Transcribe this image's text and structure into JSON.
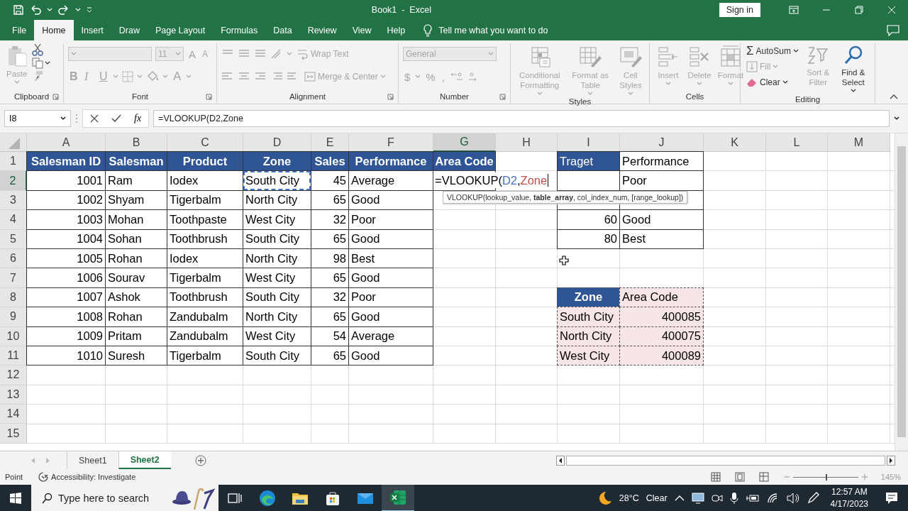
{
  "window": {
    "title": "Book1  -  Excel",
    "sign_in": "Sign in"
  },
  "menu_tabs": [
    {
      "label": "File",
      "selected": false
    },
    {
      "label": "Home",
      "selected": true
    },
    {
      "label": "Insert",
      "selected": false
    },
    {
      "label": "Draw",
      "selected": false
    },
    {
      "label": "Page Layout",
      "selected": false
    },
    {
      "label": "Formulas",
      "selected": false
    },
    {
      "label": "Data",
      "selected": false
    },
    {
      "label": "Review",
      "selected": false
    },
    {
      "label": "View",
      "selected": false
    },
    {
      "label": "Help",
      "selected": false
    }
  ],
  "tell_me": "Tell me what you want to do",
  "ribbon": {
    "clipboard": {
      "label": "Clipboard",
      "paste": "Paste",
      "disabled": true
    },
    "font": {
      "label": "Font",
      "size": "11",
      "grow": "A",
      "shrink": "A",
      "bold": "B",
      "italic": "I",
      "underline": "U",
      "text_color_letter": "A",
      "disabled": true
    },
    "alignment": {
      "label": "Alignment",
      "wrap_text": "Wrap Text",
      "merge": "Merge & Center",
      "disabled": true
    },
    "number": {
      "label": "Number",
      "format": "General",
      "currency": "$",
      "percent": "%",
      "comma": ",",
      "disabled": true
    },
    "styles": {
      "label": "Styles",
      "buttons": [
        {
          "label": "Conditional Formatting",
          "disabled": true
        },
        {
          "label": "Format as Table",
          "disabled": true
        },
        {
          "label": "Cell Styles",
          "disabled": true
        }
      ]
    },
    "cells": {
      "label": "Cells",
      "buttons": [
        {
          "label": "Insert",
          "disabled": true
        },
        {
          "label": "Delete",
          "disabled": true
        },
        {
          "label": "Format",
          "disabled": true
        }
      ]
    },
    "editing": {
      "label": "Editing",
      "sum_symbol": "Σ",
      "autosum": {
        "label": "AutoSum",
        "disabled": false
      },
      "fill": {
        "label": "Fill",
        "disabled": true
      },
      "clear": {
        "label": "Clear",
        "disabled": false
      },
      "sort": {
        "label": "Sort & Filter",
        "disabled": true
      },
      "find": {
        "label": "Find & Select",
        "disabled": false
      }
    }
  },
  "formula_bar": {
    "name_box": "I8",
    "insert_function": "fx",
    "formula": "=VLOOKUP(D2,Zone"
  },
  "sheet": {
    "columns": [
      {
        "label": "A",
        "selected": false
      },
      {
        "label": "B",
        "selected": false
      },
      {
        "label": "C",
        "selected": false
      },
      {
        "label": "D",
        "selected": false
      },
      {
        "label": "E",
        "selected": false
      },
      {
        "label": "F",
        "selected": false
      },
      {
        "label": "G",
        "selected": true
      },
      {
        "label": "H",
        "selected": false
      },
      {
        "label": "I",
        "selected": false
      },
      {
        "label": "J",
        "selected": false
      },
      {
        "label": "K",
        "selected": false
      },
      {
        "label": "L",
        "selected": false
      },
      {
        "label": "M",
        "selected": false
      }
    ],
    "rows": [
      {
        "label": "1",
        "selected": false,
        "cells": [
          {
            "kind": "header",
            "text": "Salesman ID"
          },
          {
            "kind": "header",
            "text": "Salesman"
          },
          {
            "kind": "header",
            "text": "Product"
          },
          {
            "kind": "header",
            "text": "Zone"
          },
          {
            "kind": "header",
            "text": "Sales"
          },
          {
            "kind": "header",
            "text": "Performance"
          },
          {
            "kind": "header",
            "text": "Area Code"
          },
          {
            "kind": "blank"
          },
          {
            "kind": "header-plain",
            "text": "Traget"
          },
          {
            "kind": "text",
            "text": "Performance"
          }
        ]
      },
      {
        "label": "2",
        "selected": true,
        "cells": [
          {
            "kind": "number",
            "text": "1001"
          },
          {
            "kind": "text",
            "text": "Ram"
          },
          {
            "kind": "text",
            "text": "Iodex"
          },
          {
            "kind": "ref",
            "text": "South City"
          },
          {
            "kind": "number",
            "text": "45"
          },
          {
            "kind": "text",
            "text": "Average"
          },
          {
            "kind": "formula",
            "parts": [
              {
                "text": "=VLOOKUP("
              },
              {
                "text": "D2",
                "color": "#4472c4"
              },
              {
                "text": ","
              },
              {
                "text": "Zone",
                "color": "#c0504d"
              }
            ]
          },
          {
            "kind": "blank"
          },
          {
            "kind": "boxed"
          },
          {
            "kind": "text",
            "text": "Poor"
          }
        ]
      },
      {
        "label": "3",
        "selected": false,
        "cells": [
          {
            "kind": "number",
            "text": "1002"
          },
          {
            "kind": "text",
            "text": "Shyam"
          },
          {
            "kind": "text",
            "text": "Tigerbalm"
          },
          {
            "kind": "text",
            "text": "North City"
          },
          {
            "kind": "number",
            "text": "65"
          },
          {
            "kind": "text",
            "text": "Good"
          },
          {
            "kind": "blank"
          },
          {
            "kind": "blank"
          },
          {
            "kind": "boxed"
          },
          {
            "kind": "boxed"
          }
        ]
      },
      {
        "label": "4",
        "selected": false,
        "cells": [
          {
            "kind": "number",
            "text": "1003"
          },
          {
            "kind": "text",
            "text": "Mohan"
          },
          {
            "kind": "text",
            "text": "Toothpaste"
          },
          {
            "kind": "text",
            "text": "West City"
          },
          {
            "kind": "number",
            "text": "32"
          },
          {
            "kind": "text",
            "text": "Poor"
          },
          {
            "kind": "blank"
          },
          {
            "kind": "blank"
          },
          {
            "kind": "number",
            "text": "60"
          },
          {
            "kind": "text",
            "text": "Good"
          }
        ]
      },
      {
        "label": "5",
        "selected": false,
        "cells": [
          {
            "kind": "number",
            "text": "1004"
          },
          {
            "kind": "text",
            "text": "Sohan"
          },
          {
            "kind": "text",
            "text": "Toothbrush"
          },
          {
            "kind": "text",
            "text": "South City"
          },
          {
            "kind": "number",
            "text": "65"
          },
          {
            "kind": "text",
            "text": "Good"
          },
          {
            "kind": "blank"
          },
          {
            "kind": "blank"
          },
          {
            "kind": "number",
            "text": "80"
          },
          {
            "kind": "text",
            "text": "Best"
          }
        ]
      },
      {
        "label": "6",
        "selected": false,
        "cells": [
          {
            "kind": "number",
            "text": "1005"
          },
          {
            "kind": "text",
            "text": "Rohan"
          },
          {
            "kind": "text",
            "text": "Iodex"
          },
          {
            "kind": "text",
            "text": "North City"
          },
          {
            "kind": "number",
            "text": "98"
          },
          {
            "kind": "text",
            "text": "Best"
          }
        ]
      },
      {
        "label": "7",
        "selected": false,
        "cells": [
          {
            "kind": "number",
            "text": "1006"
          },
          {
            "kind": "text",
            "text": "Sourav"
          },
          {
            "kind": "text",
            "text": "Tigerbalm"
          },
          {
            "kind": "text",
            "text": "West City"
          },
          {
            "kind": "number",
            "text": "65"
          },
          {
            "kind": "text",
            "text": "Good"
          }
        ]
      },
      {
        "label": "8",
        "selected": false,
        "cells": [
          {
            "kind": "number",
            "text": "1007"
          },
          {
            "kind": "text",
            "text": "Ashok"
          },
          {
            "kind": "text",
            "text": "Toothbrush"
          },
          {
            "kind": "text",
            "text": "South City"
          },
          {
            "kind": "number",
            "text": "32"
          },
          {
            "kind": "text",
            "text": "Poor"
          },
          {
            "kind": "blank"
          },
          {
            "kind": "blank"
          },
          {
            "kind": "lookup-header",
            "text": "Zone"
          },
          {
            "kind": "lookup-text",
            "text": "Area Code"
          }
        ]
      },
      {
        "label": "9",
        "selected": false,
        "cells": [
          {
            "kind": "number",
            "text": "1008"
          },
          {
            "kind": "text",
            "text": "Rohan"
          },
          {
            "kind": "text",
            "text": "Zandubalm"
          },
          {
            "kind": "text",
            "text": "North City"
          },
          {
            "kind": "number",
            "text": "65"
          },
          {
            "kind": "text",
            "text": "Good"
          },
          {
            "kind": "blank"
          },
          {
            "kind": "blank"
          },
          {
            "kind": "lookup-text",
            "text": "South City"
          },
          {
            "kind": "lookup-number",
            "text": "400085"
          }
        ]
      },
      {
        "label": "10",
        "selected": false,
        "cells": [
          {
            "kind": "number",
            "text": "1009"
          },
          {
            "kind": "text",
            "text": "Pritam"
          },
          {
            "kind": "text",
            "text": "Zandubalm"
          },
          {
            "kind": "text",
            "text": "West City"
          },
          {
            "kind": "number",
            "text": "54"
          },
          {
            "kind": "text",
            "text": "Average"
          },
          {
            "kind": "blank"
          },
          {
            "kind": "blank"
          },
          {
            "kind": "lookup-text",
            "text": "North City"
          },
          {
            "kind": "lookup-number",
            "text": "400075"
          }
        ]
      },
      {
        "label": "11",
        "selected": false,
        "cells": [
          {
            "kind": "number",
            "text": "1010"
          },
          {
            "kind": "text",
            "text": "Suresh"
          },
          {
            "kind": "text",
            "text": "Tigerbalm"
          },
          {
            "kind": "text",
            "text": "South City"
          },
          {
            "kind": "number",
            "text": "65"
          },
          {
            "kind": "text",
            "text": "Good"
          },
          {
            "kind": "blank"
          },
          {
            "kind": "blank"
          },
          {
            "kind": "lookup-text",
            "text": "West City"
          },
          {
            "kind": "lookup-number",
            "text": "400089"
          }
        ]
      },
      {
        "label": "12",
        "selected": false
      },
      {
        "label": "13",
        "selected": false
      },
      {
        "label": "14",
        "selected": false
      },
      {
        "label": "15",
        "selected": false
      }
    ]
  },
  "tooltip": "VLOOKUP(lookup_value, **table_array**, col_index_num, [range_lookup])",
  "sheet_tabs": [
    {
      "label": "Sheet1",
      "selected": false
    },
    {
      "label": "Sheet2",
      "selected": true
    }
  ],
  "status_bar": {
    "mode": "Point",
    "accessibility": "Accessibility: Investigate",
    "zoom": {
      "level": 0.5,
      "reading": "145%"
    }
  },
  "taskbar": {
    "search": {
      "placeholder": "Type here to search"
    },
    "apps": [
      {
        "selected": false
      },
      {
        "selected": false
      },
      {
        "selected": false
      },
      {
        "selected": false
      },
      {
        "selected": false
      },
      {
        "selected": true
      }
    ],
    "temperature": "28°C",
    "weather": "Clear",
    "time": "12:57 AM",
    "date": "4/17/2023"
  }
}
